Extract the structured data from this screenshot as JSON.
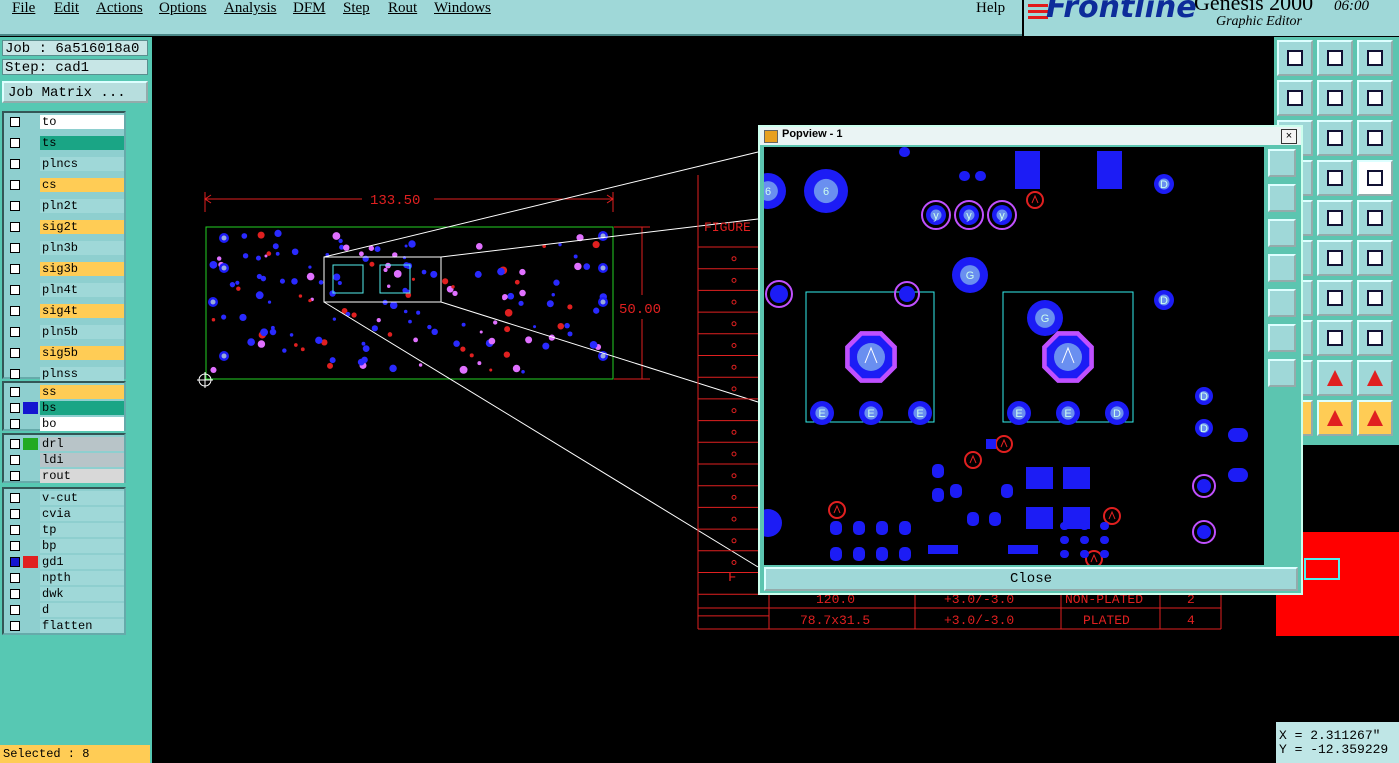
{
  "menu": {
    "file": "File",
    "edit": "Edit",
    "actions": "Actions",
    "options": "Options",
    "analysis": "Analysis",
    "dfm": "DFM",
    "step": "Step",
    "rout": "Rout",
    "windows": "Windows",
    "help": "Help"
  },
  "brand": {
    "logo": "Frontline",
    "product": "Genesis 2000",
    "version": "06:00",
    "subtitle": "Graphic Editor"
  },
  "job": {
    "job_label": "Job : 6a516018a0",
    "step_label": "Step: cad1",
    "matrix_button": "Job Matrix ..."
  },
  "layers": [
    {
      "name": "to",
      "color": "#ffffff"
    },
    {
      "name": "ts",
      "color": "#1aa585"
    },
    {
      "name": "plncs",
      "color": "#9fd8d8"
    },
    {
      "name": "cs",
      "color": "#ffcc55"
    },
    {
      "name": "pln2t",
      "color": "#9fd8d8"
    },
    {
      "name": "sig2t",
      "color": "#ffcc55"
    },
    {
      "name": "pln3b",
      "color": "#9fd8d8"
    },
    {
      "name": "sig3b",
      "color": "#ffcc55"
    },
    {
      "name": "pln4t",
      "color": "#9fd8d8"
    },
    {
      "name": "sig4t",
      "color": "#ffcc55"
    },
    {
      "name": "pln5b",
      "color": "#9fd8d8"
    },
    {
      "name": "sig5b",
      "color": "#ffcc55"
    },
    {
      "name": "plnss",
      "color": "#9fd8d8"
    },
    {
      "name": "ss",
      "color": "#ffcc55"
    },
    {
      "name": "bs",
      "color": "#1aa585"
    },
    {
      "name": "bo",
      "color": "#ffffff"
    },
    {
      "name": "drl",
      "color": "#b8c4c8"
    },
    {
      "name": "ldi",
      "color": "#b8c4c8"
    },
    {
      "name": "rout",
      "color": "#d8d8d8"
    },
    {
      "name": "v-cut",
      "color": "#9fd8d8"
    },
    {
      "name": "cvia",
      "color": "#9fd8d8"
    },
    {
      "name": "tp",
      "color": "#9fd8d8"
    },
    {
      "name": "bp",
      "color": "#9fd8d8"
    },
    {
      "name": "gd1",
      "color": "#9fd8d8"
    },
    {
      "name": "npth",
      "color": "#9fd8d8"
    },
    {
      "name": "dwk",
      "color": "#9fd8d8"
    },
    {
      "name": "d",
      "color": "#9fd8d8"
    },
    {
      "name": "flatten",
      "color": "#9fd8d8"
    }
  ],
  "status": {
    "selected": "Selected : 8"
  },
  "board": {
    "width_dim": "133.50",
    "height_dim": "50.00"
  },
  "table": {
    "header": "FIGURE",
    "row1": [
      "120.0",
      "+3.0/-3.0",
      "NON-PLATED",
      "2"
    ],
    "row2": [
      "78.7x31.5",
      "+3.0/-3.0",
      "PLATED",
      "4"
    ],
    "symbol_F": "F"
  },
  "popview": {
    "title": "Popview - 1",
    "close_label": "Close",
    "close_x": "×",
    "pad_labels": {
      "y": "y",
      "G": "G",
      "E": "E",
      "D": "D",
      "six": "6"
    }
  },
  "coords": {
    "x": "X = 2.311267\"",
    "y": "Y = -12.359229"
  },
  "colors": {
    "accent": "#9fd8d8",
    "panel": "#57c8b3",
    "pad": "#1c1cf5",
    "outline": "#e02020"
  }
}
